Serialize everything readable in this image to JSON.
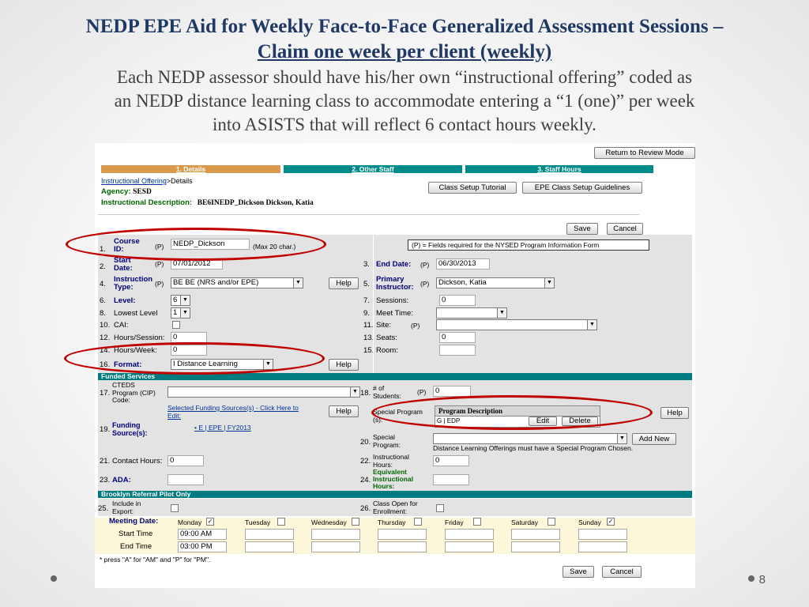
{
  "slide": {
    "title_line1": "NEDP EPE Aid for Weekly Face-to-Face Generalized Assessment Sessions –",
    "title_line2": "Claim one week per client (weekly)",
    "body_line1": "Each NEDP assessor should have his/her own “instructional offering” coded as",
    "body_line2": "an NEDP distance learning class to accommodate entering a “1 (one)” per week",
    "body_line3": "into ASISTS that will reflect 6 contact hours weekly.",
    "page_number": "8"
  },
  "app": {
    "return_button": "Return to Review Mode",
    "steps": [
      "1. Details",
      "2. Other Staff",
      "3. Staff Hours"
    ],
    "breadcrumb_link": "Instructional Offering",
    "breadcrumb_rest": ">Details",
    "agency_label": "Agency:",
    "agency_value": "SESD",
    "instr_desc_label": "Instructional Description:",
    "instr_desc_value": "BE6INEDP_Dickson Dickson, Katia",
    "class_setup_tutorial": "Class Setup Tutorial",
    "epe_guidelines": "EPE Class Setup Guidelines",
    "save": "Save",
    "cancel": "Cancel",
    "required_note": "(P) = Fields required for the NYSED Program Information Form",
    "p": "(P)",
    "help": "Help",
    "fields": {
      "f1_num": "1.",
      "f1_label_a": "Course",
      "f1_label_b": "ID:",
      "f1_value": "NEDP_Dickson",
      "f1_hint": "(Max 20 char.)",
      "f2_num": "2.",
      "f2_label_a": "Start",
      "f2_label_b": "Date:",
      "f2_value": "07/01/2012",
      "f3_num": "3.",
      "f3_label": "End Date:",
      "f3_value": "06/30/2013",
      "f4_num": "4.",
      "f4_label_a": "Instruction",
      "f4_label_b": "Type:",
      "f4_value": "BE BE (NRS and/or EPE)",
      "f5_num": "5.",
      "f5_label_a": "Primary",
      "f5_label_b": "Instructor:",
      "f5_value": "Dickson, Katia",
      "f6_num": "6.",
      "f6_label": "Level:",
      "f6_value": "6",
      "f7_num": "7.",
      "f7_label": "Sessions:",
      "f7_value": "0",
      "f8_num": "8.",
      "f8_label": "Lowest Level",
      "f8_value": "1",
      "f9_num": "9.",
      "f9_label": "Meet Time:",
      "f10_num": "10.",
      "f10_label": "CAI:",
      "f11_num": "11.",
      "f11_label": "Site:",
      "f12_num": "12.",
      "f12_label": "Hours/Session:",
      "f12_value": "0",
      "f13_num": "13.",
      "f13_label": "Seats:",
      "f13_value": "0",
      "f14_num": "14.",
      "f14_label": "Hours/Week:",
      "f14_value": "0",
      "f15_num": "15.",
      "f15_label": "Room:",
      "f16_num": "16.",
      "f16_label": "Format:",
      "f16_value": "I Distance Learning"
    },
    "funded_services_bar": "Funded Services",
    "fs": {
      "f17_num": "17.",
      "f17_label_a": "CTEDS",
      "f17_label_b": "Program (CIP)",
      "f17_label_c": "Code:",
      "f18_num": "18.",
      "f18_label_a": "# of",
      "f18_label_b": "Students:",
      "f18_value": "0",
      "selected_funding_a": "Selected Funding Sources(s) - Click Here to",
      "selected_funding_b": "Edit:",
      "f19_num": "19.",
      "f19_label_a": "Funding",
      "f19_label_b": "Source(s):",
      "funding_item": "E | EPE | FY2013",
      "special_prog_label_a": "Special Program",
      "special_prog_label_b": "(s):",
      "program_desc_header": "Program Description",
      "program_row": "G | EDP",
      "edit": "Edit",
      "delete": "Delete",
      "f20_num": "20.",
      "f20_label_a": "Special",
      "f20_label_b": "Program:",
      "add_new": "Add New",
      "dl_note": "Distance Learning Offerings must have a Special Program Chosen.",
      "f21_num": "21.",
      "f21_label": "Contact Hours:",
      "f21_value": "0",
      "f22_num": "22.",
      "f22_label_a": "Instructional",
      "f22_label_b": "Hours:",
      "f22_value": "0",
      "f23_num": "23.",
      "f23_label": "ADA:",
      "f24_num": "24.",
      "f24_label_a": "Equivalent",
      "f24_label_b": "Instructional",
      "f24_label_c": "Hours:"
    },
    "brooklyn_bar": "Brooklyn Referral Pilot Only",
    "bk": {
      "f25_num": "25.",
      "f25_label_a": "Include in",
      "f25_label_b": "Export:",
      "f26_num": "26.",
      "f26_label_a": "Class Open for",
      "f26_label_b": "Enrollment:"
    },
    "meeting": {
      "label": "Meeting Date:",
      "days": [
        "Monday",
        "Tuesday",
        "Wednesday",
        "Thursday",
        "Friday",
        "Saturday",
        "Sunday"
      ],
      "start_label": "Start Time",
      "end_label": "End Time",
      "monday_start": "09:00 AM",
      "monday_end": "03:00 PM",
      "note": "* press \"A\" for \"AM\" and \"P\" for \"PM\".",
      "check_mark": "✓"
    },
    "dropdown_glyph": "▼"
  },
  "colors": {
    "title": "#1f3864",
    "step1": "#d99a4e",
    "step_other": "#008b8b",
    "teal_bar": "#007b80",
    "highlight_oval": "#c00000"
  }
}
